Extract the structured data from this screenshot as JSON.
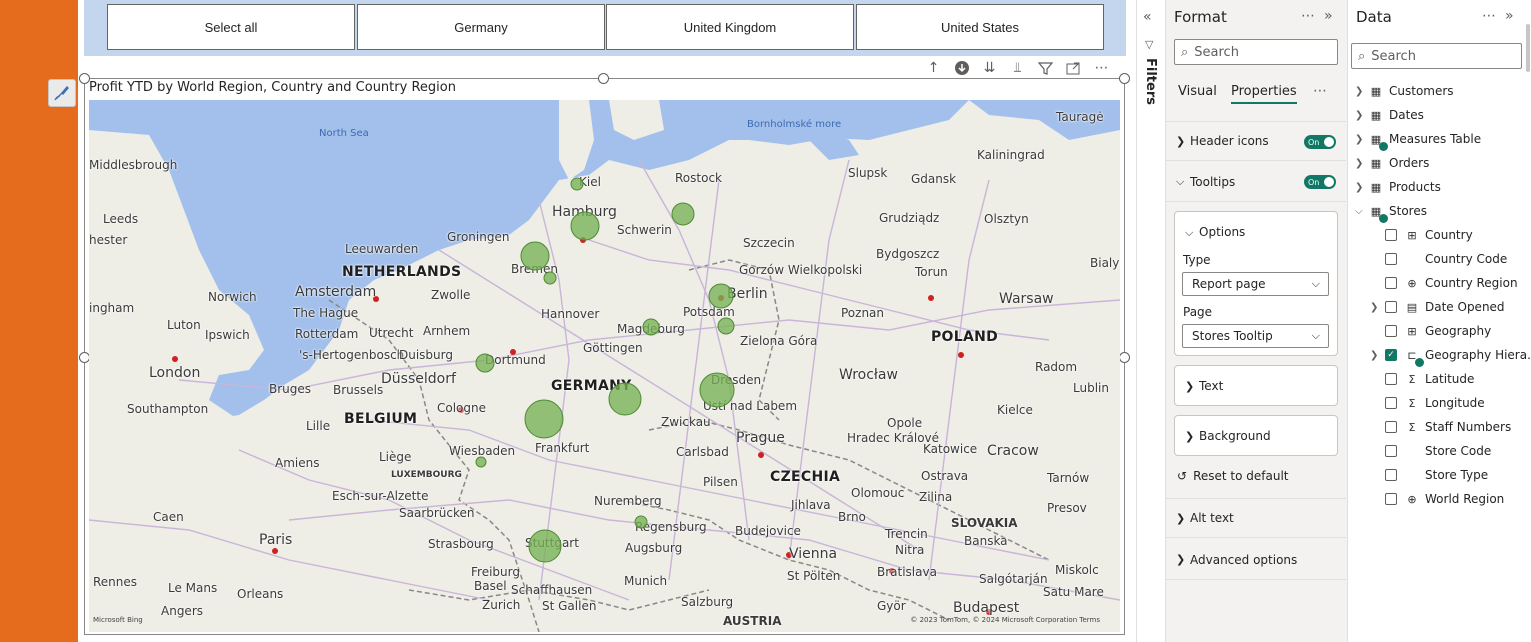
{
  "slicer": {
    "buttons": [
      "Select all",
      "Germany",
      "United Kingdom",
      "United States"
    ]
  },
  "visual": {
    "title": "Profit YTD by World Region, Country and Country Region",
    "attribution": "© 2023 TomTom, © 2024 Microsoft Corporation  Terms",
    "bing": "Microsoft Bing",
    "map_labels": {
      "seas": [
        "North Sea",
        "Bornholmské more"
      ],
      "countries": [
        "NETHERLANDS",
        "BELGIUM",
        "LUXEMBOURG",
        "GERMANY",
        "POLAND",
        "CZECHIA",
        "SLOVAKIA",
        "AUSTRIA"
      ],
      "cities": [
        "Middlesbrough",
        "Leeds",
        "hester",
        "Norwich",
        "ingham",
        "Luton",
        "Ipswich",
        "London",
        "Southampton",
        "Amsterdam",
        "The Hague",
        "Rotterdam",
        "Utrecht",
        "Leeuwarden",
        "Groningen",
        "Zwolle",
        "Arnhem",
        "'s-Hertogenbosch",
        "Duisburg",
        "Dortmund",
        "Düsseldorf",
        "Bruges",
        "Brussels",
        "Cologne",
        "Lille",
        "Amiens",
        "Liège",
        "Wiesbaden",
        "Frankfurt",
        "Esch-sur-Alzette",
        "Saarbrücken",
        "Caen",
        "Paris",
        "Strasbourg",
        "Rennes",
        "Le Mans",
        "Orleans",
        "Angers",
        "Basel",
        "Zurich",
        "Schaffhausen",
        "St Gallen",
        "Freiburg",
        "Stuttgart",
        "Augsburg",
        "Munich",
        "Salzburg",
        "Regensburg",
        "Nuremberg",
        "Pilsen",
        "Carlsbad",
        "Budejovice",
        "Zwickau",
        "Prague",
        "Dresden",
        "Ustí nad Labem",
        "Hradec Králové",
        "Olomouc",
        "Ostrava",
        "Brno",
        "Jihlava",
        "Zilina",
        "Trencin",
        "Nitra",
        "Bratislava",
        "Vienna",
        "St Pölten",
        "Györ",
        "Budapest",
        "Salgótarján",
        "Miskolc",
        "Banska",
        "Presov",
        "Tarnów",
        "Katowice",
        "Cracow",
        "Opole",
        "Kielce",
        "Radom",
        "Lublin",
        "Warsaw",
        "Wrocław",
        "Poznan",
        "Zielona Góra",
        "Gorzów Wielkopolski",
        "Szczecin",
        "Bydgoszcz",
        "Torun",
        "Grudziądz",
        "Gdansk",
        "Kaliningrad",
        "Olsztyn",
        "Slupsk",
        "Rostock",
        "Kiel",
        "Hamburg",
        "Schwerin",
        "Bremen",
        "Hannover",
        "Magdeburg",
        "Potsdam",
        "Berlin",
        "Göttingen",
        "Tauragė",
        "Bialys",
        "Satu Mare"
      ]
    }
  },
  "filters": {
    "label": "Filters"
  },
  "format": {
    "title": "Format",
    "search_placeholder": "Search",
    "tabs": [
      "Visual",
      "Properties"
    ],
    "sections": {
      "header_icons": "Header icons",
      "tooltips": "Tooltips",
      "options": "Options",
      "type_label": "Type",
      "type_value": "Report page",
      "page_label": "Page",
      "page_value": "Stores Tooltip",
      "text": "Text",
      "background": "Background",
      "reset": "Reset to default",
      "alt_text": "Alt text",
      "advanced": "Advanced options"
    },
    "toggle_on": "On"
  },
  "data": {
    "title": "Data",
    "search_placeholder": "Search",
    "tables": [
      "Customers",
      "Dates",
      "Measures Table",
      "Orders",
      "Products",
      "Stores"
    ],
    "fields": [
      {
        "label": "Country",
        "checked": false,
        "icon": "geo-icon"
      },
      {
        "label": "Country Code",
        "checked": false,
        "icon": ""
      },
      {
        "label": "Country Region",
        "checked": false,
        "icon": "globe-icon"
      },
      {
        "label": "Date Opened",
        "checked": false,
        "icon": "calendar-icon"
      },
      {
        "label": "Geography",
        "checked": false,
        "icon": "geo-icon"
      },
      {
        "label": "Geography Hiera...",
        "checked": true,
        "icon": "hierarchy-icon"
      },
      {
        "label": "Latitude",
        "checked": false,
        "icon": "sigma-icon"
      },
      {
        "label": "Longitude",
        "checked": false,
        "icon": "sigma-icon"
      },
      {
        "label": "Staff Numbers",
        "checked": false,
        "icon": "sigma-icon"
      },
      {
        "label": "Store Code",
        "checked": false,
        "icon": ""
      },
      {
        "label": "Store Type",
        "checked": false,
        "icon": ""
      },
      {
        "label": "World Region",
        "checked": false,
        "icon": "globe-icon"
      }
    ]
  },
  "colors": {
    "accent": "#117865",
    "bubble": "#6aa84f",
    "orange": "#e46c1c",
    "water": "#a3c0ec"
  }
}
